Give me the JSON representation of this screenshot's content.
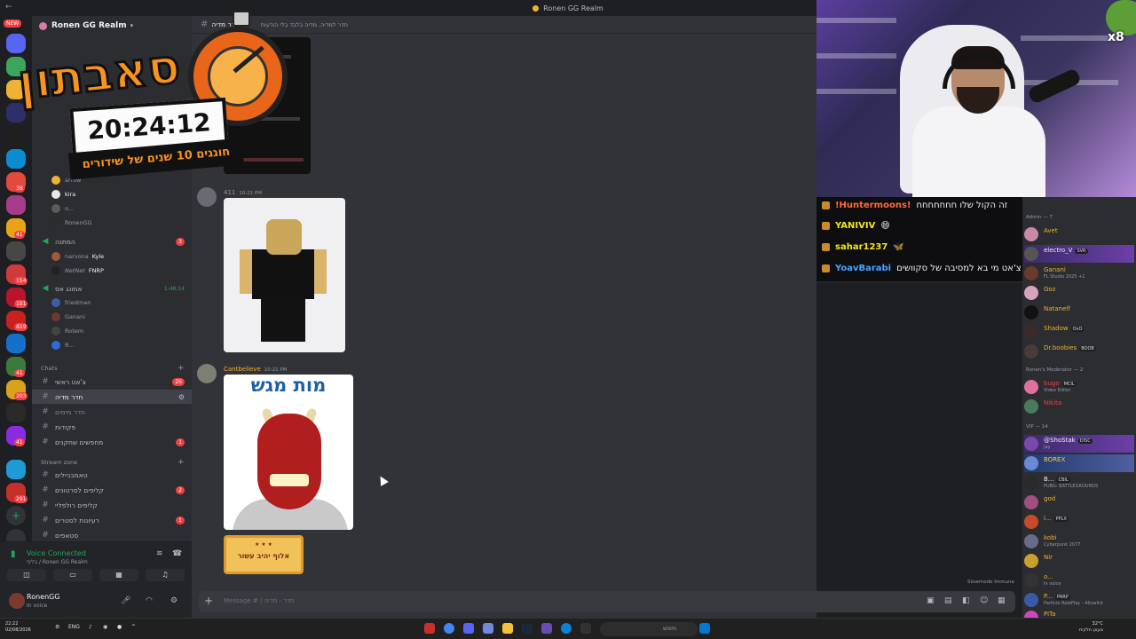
{
  "window": {
    "title": "Ronen GG Realm",
    "back_label": "←"
  },
  "rail": {
    "new_badge": "NEW",
    "badges": [
      "38",
      "41",
      "154",
      "181",
      "819",
      "41",
      "203",
      "41",
      "291"
    ]
  },
  "server": {
    "name": "Ronen GG Realm"
  },
  "channels": {
    "top_voice_users": [
      "arrow",
      "kira",
      "o...",
      "RonenGG"
    ],
    "voice_hamtana": {
      "name": "המתנה",
      "badge": "3"
    },
    "voice_hamtana_users": [
      {
        "name": "narvona",
        "tag": "Kyle"
      },
      {
        "name": "NetNet",
        "tag": "FNRP"
      }
    ],
    "voice_amonag": {
      "name": "אמונג אס",
      "timer": "1:48:14"
    },
    "voice_amonag_users": [
      "friedman",
      "Ganani",
      "Rotem",
      "R..."
    ],
    "chats_category": "Chats",
    "chats": [
      {
        "name": "צ'אט ראשי",
        "badge": "26"
      },
      {
        "name": "חדר מדיה",
        "badge": ""
      },
      {
        "name": "חדר מימים",
        "badge": ""
      },
      {
        "name": "פקודות",
        "badge": ""
      },
      {
        "name": "מחפשים שחקנים",
        "badge": "1"
      }
    ],
    "stream_category": "Stream zone",
    "stream": [
      {
        "name": "טאמבניילים",
        "badge": ""
      },
      {
        "name": "קליפים לסרטונים",
        "badge": "2"
      },
      {
        "name": "קליפים רולפליי",
        "badge": ""
      },
      {
        "name": "רעיונות לסטרים",
        "badge": "1"
      },
      {
        "name": "סטאפים",
        "badge": ""
      }
    ]
  },
  "voice_connected": {
    "status": "Voice Connected",
    "detail": "בליף / Ronen GG Realm"
  },
  "user_panel": {
    "name": "RonenGG",
    "status": "In voice"
  },
  "channel_header": {
    "name": "חדר מדיה",
    "topic": "חדר למדיה. מדיה בלבד בלי הודעות"
  },
  "messages": [
    {
      "author": "",
      "badge_count": "411",
      "time": "10:21 PM"
    },
    {
      "author": "Cantbelieve",
      "time": "10:21 PM"
    }
  ],
  "media": {
    "meme_text": "מות מגש",
    "card_text": "אלוף יהיב עשור"
  },
  "composer": {
    "placeholder": "Message # | חדר - מדיה"
  },
  "slowmode": "Slowmode Immune",
  "overlay": {
    "title": "סאבתון",
    "timer": "20:24:12",
    "subtitle": "חוגגים 10 שנים של שידורים",
    "multiplier": "x8"
  },
  "twitch_chat": [
    {
      "user": "!Huntermoons!",
      "color": "#ff6a3d",
      "text": "זה הקול שלו חחחחחחח"
    },
    {
      "user": "YANIVIV",
      "color": "#f6e61f",
      "text": "😄"
    },
    {
      "user": "sahar1237",
      "color": "#f6e61f",
      "text": "🦋"
    },
    {
      "user": "YoavBarabi",
      "color": "#4aa3ff",
      "text": "צ'אט מי בא למסיבה של סקוושים"
    }
  ],
  "members": {
    "admin_header": "Admin — 7",
    "admins": [
      {
        "name": "Avet",
        "color": "#f0b232",
        "sub": "",
        "tag": ""
      },
      {
        "name": "electro_V",
        "color": "#f2f3f5",
        "sub": "",
        "tag": "SVR"
      },
      {
        "name": "Ganani",
        "color": "#f0b232",
        "sub": "FL Studio 2025 +1",
        "tag": ""
      },
      {
        "name": "Goz",
        "color": "#f0b232",
        "sub": "",
        "tag": ""
      },
      {
        "name": "Natanelf",
        "color": "#f0b232",
        "sub": "",
        "tag": ""
      },
      {
        "name": "Shadow",
        "color": "#f0b232",
        "sub": "",
        "tag": "OvO"
      },
      {
        "name": "Dr.boobies",
        "color": "#f0b232",
        "sub": "",
        "tag": "BOOB"
      }
    ],
    "mod_header": "Ronen's Moderator — 2",
    "mods": [
      {
        "name": "bugo",
        "color": "#f23f42",
        "sub": "Video Editor",
        "tag": "MCIL"
      },
      {
        "name": "Nikita",
        "color": "#f23f42",
        "sub": "",
        "tag": ""
      }
    ],
    "vip_header": "VIP — 14",
    "vips": [
      {
        "name": "@ShoStak",
        "color": "#f2f3f5",
        "sub": "Jay",
        "tag": "DISC"
      },
      {
        "name": "BOREX",
        "color": "#f2c94c",
        "sub": "",
        "tag": ""
      },
      {
        "name": "B...",
        "color": "#f2f3f5",
        "sub": "PUBG: BATTLEGROUNDS",
        "tag": "CBIL"
      },
      {
        "name": "god",
        "color": "#f0b232",
        "sub": "",
        "tag": ""
      },
      {
        "name": "i...",
        "color": "#f0b232",
        "sub": "",
        "tag": "PPLX"
      },
      {
        "name": "kobi",
        "color": "#f0b232",
        "sub": "Cyberpunk 2077",
        "tag": ""
      },
      {
        "name": "Nir",
        "color": "#f0b232",
        "sub": "",
        "tag": ""
      },
      {
        "name": "o...",
        "color": "#f0b232",
        "sub": "In voice",
        "tag": ""
      },
      {
        "name": "P...",
        "color": "#f0b232",
        "sub": "Particle RolePlay - Allowlist",
        "tag": "PRRP"
      },
      {
        "name": "PiTa",
        "color": "#f0b232",
        "sub": "",
        "tag": ""
      }
    ]
  },
  "taskbar": {
    "time": "22:22",
    "date": "02/08/2026",
    "lang": "ENG",
    "search": "חיפוש",
    "weather": "32°C",
    "weather_sub": "מעונן חלקית"
  }
}
